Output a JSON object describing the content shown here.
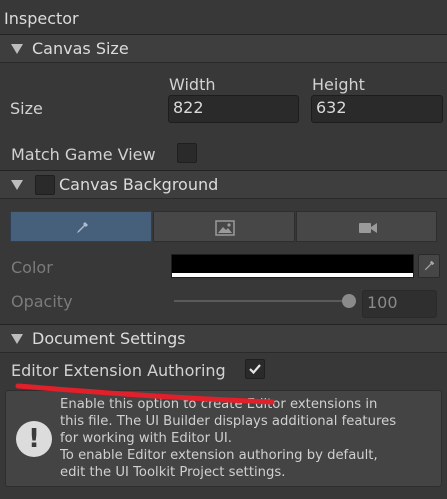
{
  "inspector": {
    "title": "Inspector"
  },
  "canvas_size": {
    "header": "Canvas Size",
    "size_label": "Size",
    "width_label": "Width",
    "height_label": "Height",
    "width_value": "822",
    "height_value": "632",
    "match_game_view_label": "Match Game View",
    "match_game_view_checked": false
  },
  "canvas_background": {
    "header": "Canvas Background",
    "enabled": false,
    "tabs": [
      {
        "icon": "eyedropper-icon",
        "active": true
      },
      {
        "icon": "image-icon",
        "active": false
      },
      {
        "icon": "camera-icon",
        "active": false
      }
    ],
    "color_label": "Color",
    "color_value": "#000000",
    "opacity_label": "Opacity",
    "opacity_value": "100"
  },
  "document_settings": {
    "header": "Document Settings",
    "editor_extension_label": "Editor Extension Authoring",
    "editor_extension_checked": true,
    "help_lines": [
      "Enable this option to create Editor extensions in",
      "this file. The UI Builder displays additional features",
      "for working with Editor UI.",
      "To enable Editor extension authoring by default,",
      "edit the UI Toolkit Project settings."
    ]
  },
  "colors": {
    "accent_tab": "#46607c",
    "annotation": "#e0202a",
    "panel": "#383838"
  }
}
